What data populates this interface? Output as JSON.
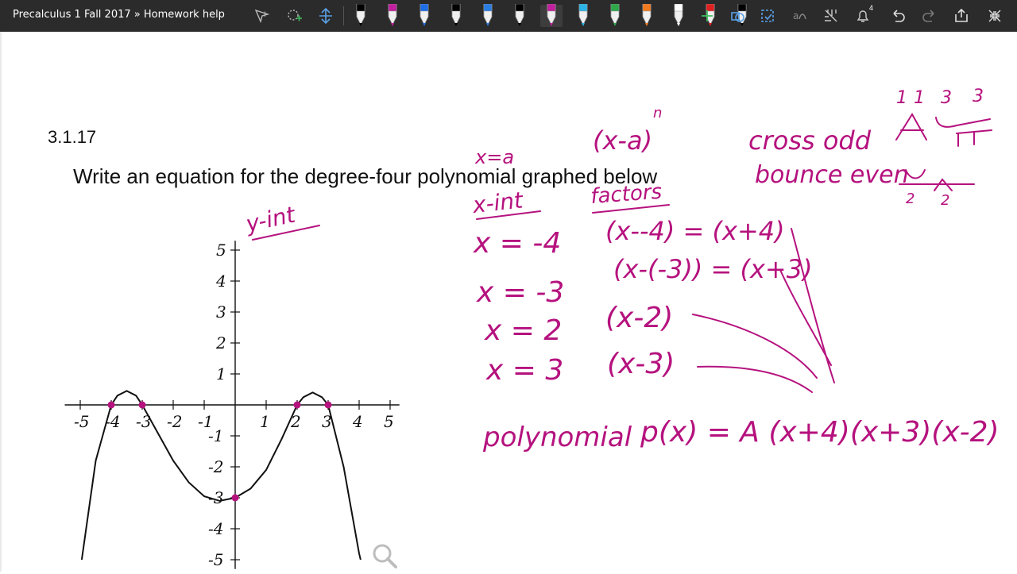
{
  "window": {
    "title": "Precalculus 1 Fall 2017 » Homework help",
    "notification_count": "4"
  },
  "toolbar": {
    "pen_colors": [
      "#000000",
      "#c21e9e",
      "#1e6ee6",
      "#000000",
      "#2a7de1",
      "#000000",
      "#c21e9e",
      "#2ab5e6",
      "#2ea84a",
      "#f27a1e",
      "#ffffff",
      "#e02020",
      "#000000"
    ]
  },
  "problem": {
    "number": "3.1.17",
    "text": "Write an equation for the degree-four polynomial graphed below"
  },
  "graph": {
    "x_ticks": [
      "-5",
      "-4",
      "-3",
      "-2",
      "-1",
      "1",
      "2",
      "3",
      "4",
      "5"
    ],
    "y_ticks": [
      "5",
      "4",
      "3",
      "2",
      "1",
      "-1",
      "-2",
      "-3",
      "-4",
      "-5"
    ]
  },
  "chart_data": {
    "type": "line",
    "xlim": [
      -5,
      5
    ],
    "ylim": [
      -5,
      5
    ],
    "grid": false,
    "series": [
      {
        "x": [
          -4.95,
          -4.5,
          -4,
          -3.8,
          -3.5,
          -3.2,
          -3,
          -2.5,
          -2,
          -1.5,
          -1,
          -0.5,
          0,
          0.5,
          1,
          1.5,
          2,
          2.2,
          2.5,
          2.8,
          3,
          3.5,
          4,
          4.05
        ],
        "y": [
          -5,
          -1.8,
          0,
          0.3,
          0.45,
          0.3,
          0,
          -0.9,
          -1.8,
          -2.5,
          -2.95,
          -3.1,
          -3,
          -2.7,
          -2.1,
          -1.1,
          0,
          0.25,
          0.4,
          0.25,
          0,
          -2,
          -4.8,
          -5
        ]
      }
    ],
    "points": [
      {
        "x": -4,
        "y": 0
      },
      {
        "x": -3,
        "y": 0
      },
      {
        "x": 2,
        "y": 0
      },
      {
        "x": 3,
        "y": 0
      },
      {
        "x": 0,
        "y": -3
      }
    ]
  },
  "ink": {
    "y_int": "y-int",
    "x_equals_a": "x=a",
    "x_int": "x-int",
    "roots": [
      "x = -4",
      "x = -3",
      "x = 2",
      "x = 3"
    ],
    "factor_form": "(x-a)",
    "exponent": "n",
    "factors_label": "factors",
    "factors": [
      "(x--4) = (x+4)",
      "(x-(-3)) = (x+3)",
      "(x-2)",
      "(x-3)"
    ],
    "cross_odd": "cross odd",
    "bounce_even": "bounce even",
    "multiplicities": [
      "1",
      "1",
      "3",
      "3"
    ],
    "bounce_mults": [
      "2",
      "2"
    ],
    "polynomial_label": "polynomial",
    "polynomial_eq": "p(x) = A (x+4)(x+3)(x-2)"
  }
}
